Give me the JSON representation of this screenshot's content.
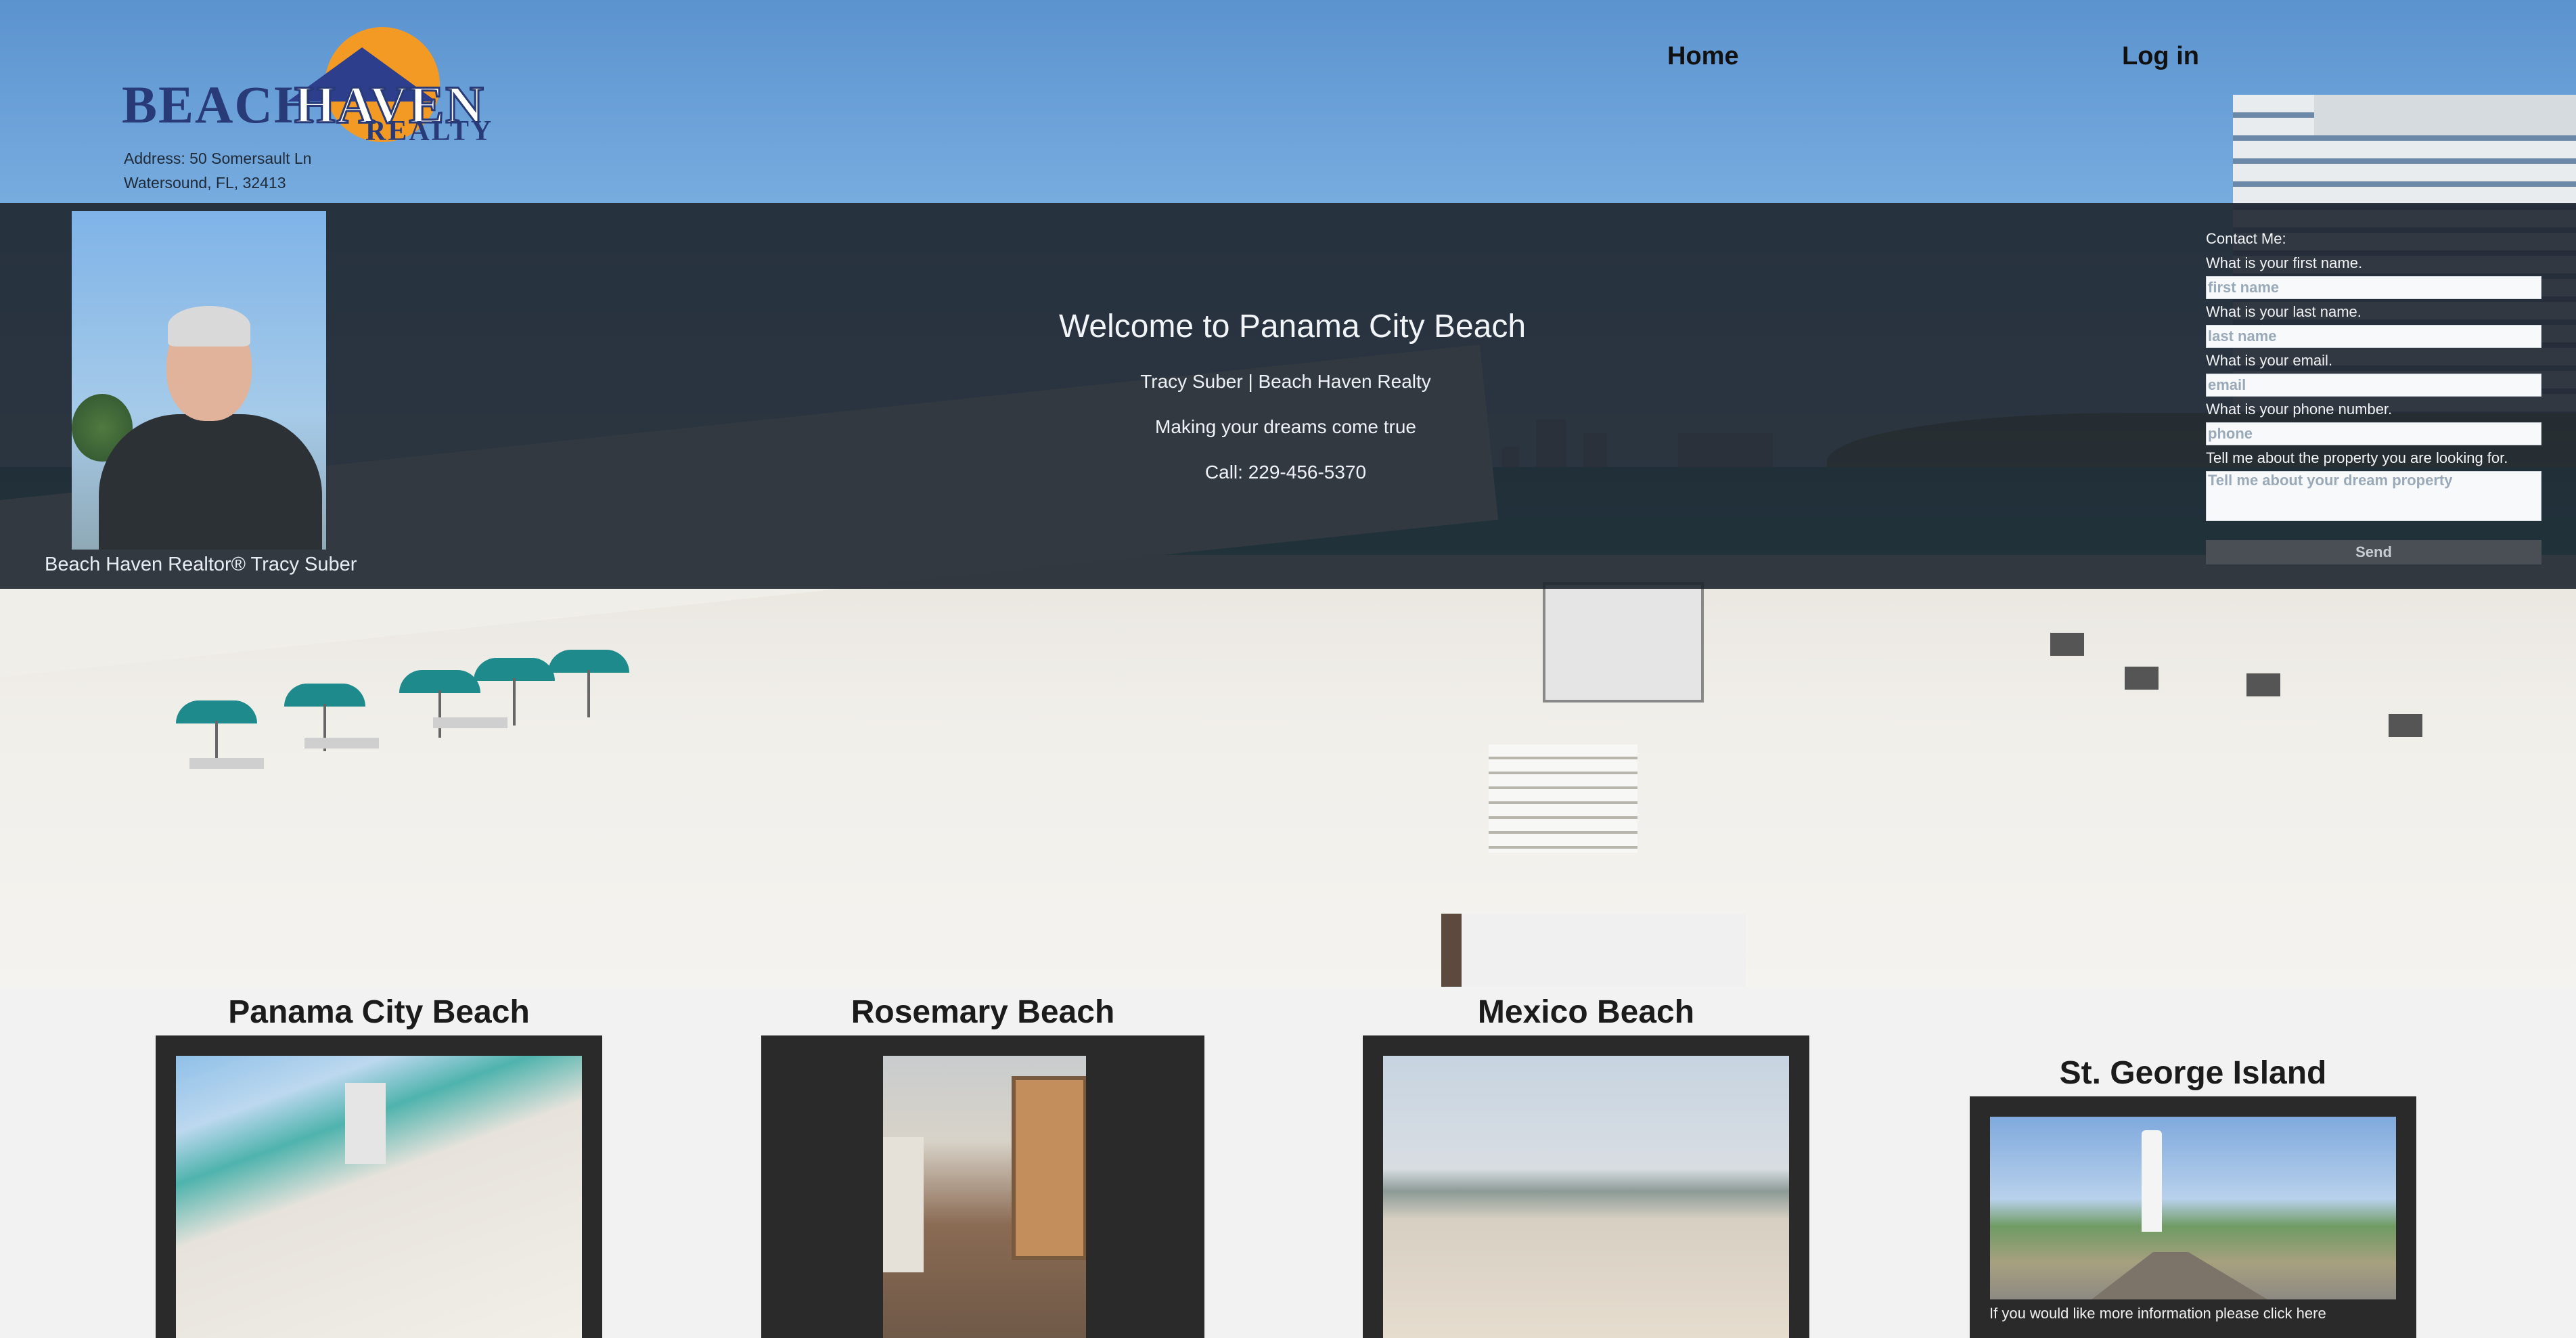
{
  "brand": {
    "logo_word1": "BEACH",
    "logo_word2": "HAVEN",
    "logo_word3": "REALTY",
    "address_line1": "Address: 50 Somersault Ln",
    "address_line2": "Watersound, FL, 32413"
  },
  "nav": {
    "home": "Home",
    "login": "Log in"
  },
  "hero": {
    "photo_caption": "Beach Haven Realtor® Tracy Suber",
    "title": "Welcome to Panama City Beach",
    "line1": "Tracy Suber | Beach Haven Realty",
    "line2": "Making your dreams come true",
    "line3": "Call: 229-456-5370"
  },
  "contact": {
    "heading": "Contact Me:",
    "first_label": "What is your first name.",
    "first_placeholder": "first name",
    "last_label": "What is your last name.",
    "last_placeholder": "last name",
    "email_label": "What is your email.",
    "email_placeholder": "email",
    "phone_label": "What is your phone number.",
    "phone_placeholder": "phone",
    "message_label": "Tell me about the property you are looking for.",
    "message_placeholder": "Tell me about your dream property",
    "send": "Send"
  },
  "cards": [
    {
      "title": "Panama City Beach"
    },
    {
      "title": "Rosemary Beach"
    },
    {
      "title": "Mexico Beach"
    },
    {
      "title": "St. George Island",
      "link": "If you would like more information please click here"
    }
  ],
  "colors": {
    "band": "#1e252d",
    "card": "#2a2a2a",
    "logo_blue": "#283a78",
    "logo_orange": "#f39a24"
  }
}
